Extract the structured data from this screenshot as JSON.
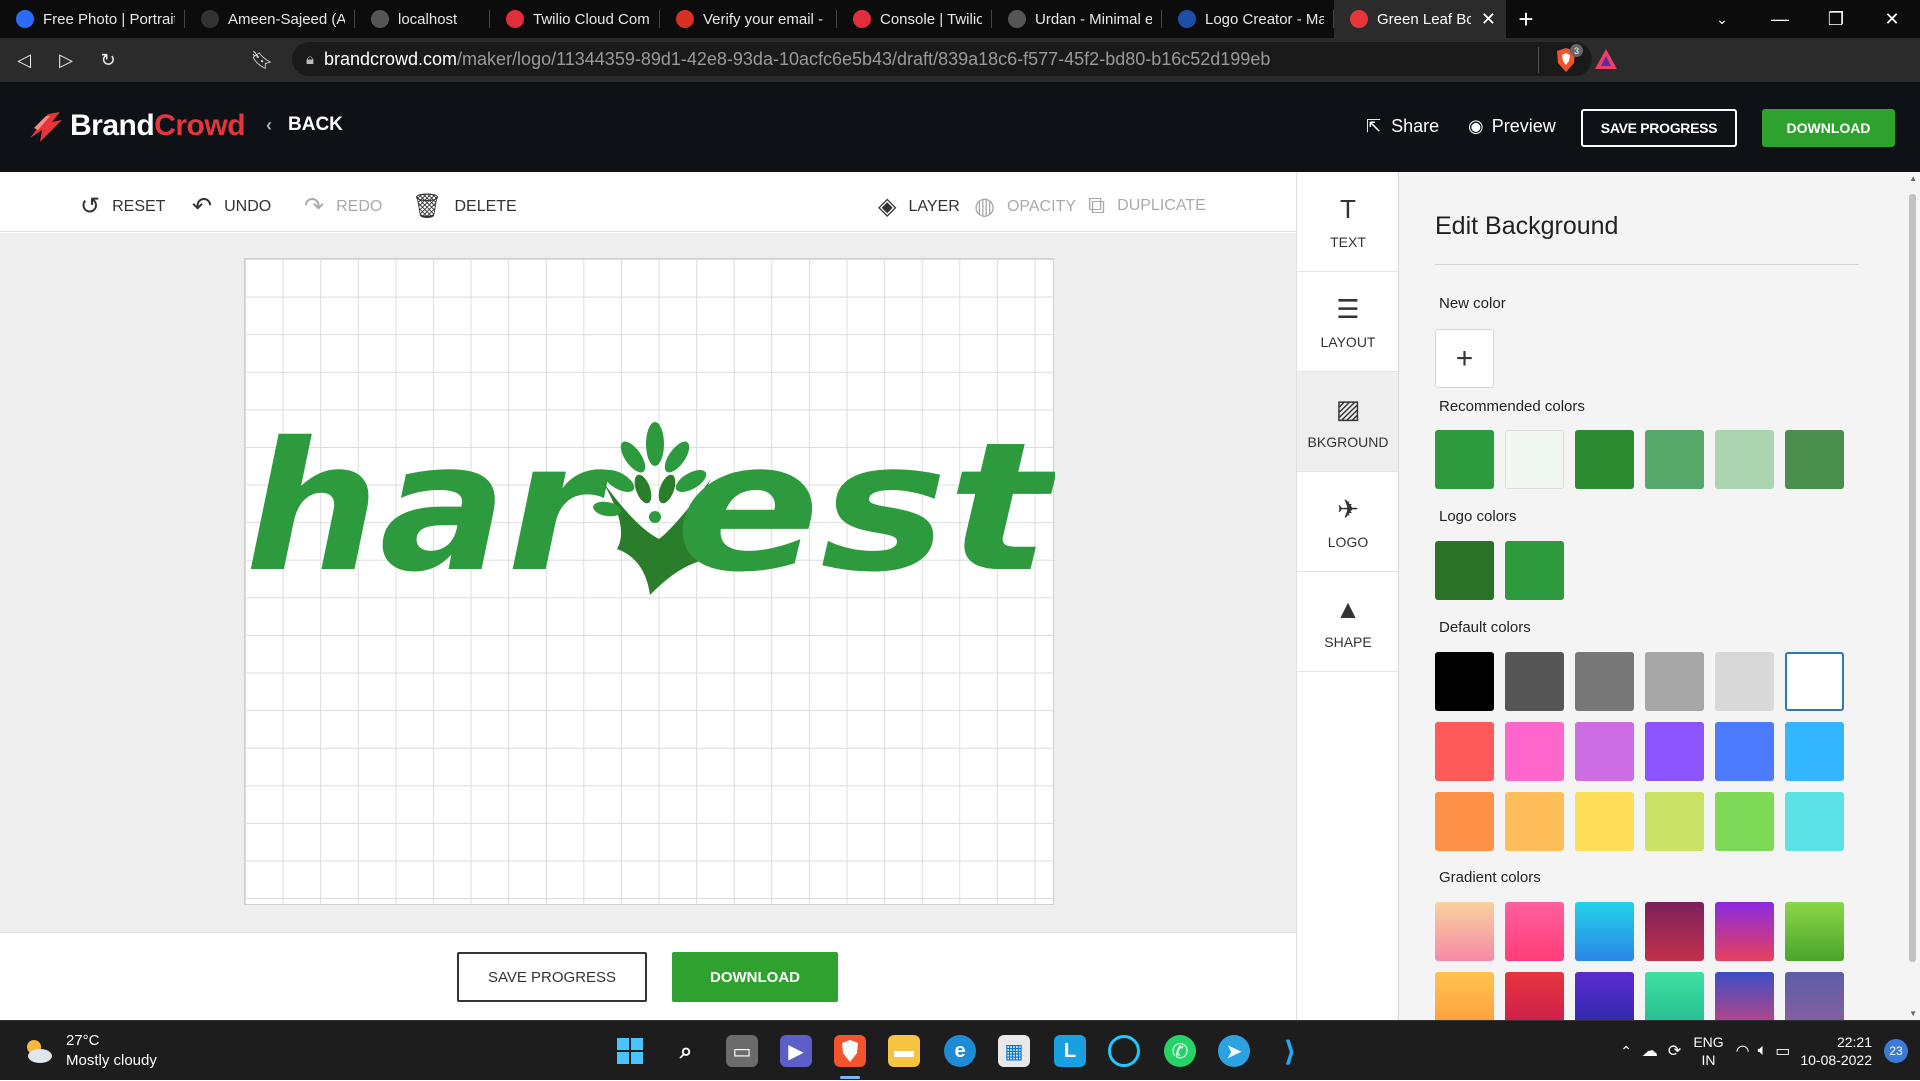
{
  "browser": {
    "tabs": [
      {
        "label": "Free Photo | Portrait",
        "icon": "freepik-icon",
        "color": "#2b6cff"
      },
      {
        "label": "Ameen-Sajeed (AM",
        "icon": "github-icon",
        "color": "#333333"
      },
      {
        "label": "localhost",
        "icon": "globe-icon",
        "color": "#555555"
      },
      {
        "label": "Twilio Cloud Comm",
        "icon": "twilio-icon",
        "color": "#e22d3b"
      },
      {
        "label": "Verify your email - ",
        "icon": "gmail-icon",
        "color": "#d93025"
      },
      {
        "label": "Console | Twilio",
        "icon": "twilio-icon",
        "color": "#e22d3b"
      },
      {
        "label": "Urdan - Minimal eC",
        "icon": "globe-icon",
        "color": "#555555"
      },
      {
        "label": "Logo Creator - Mak",
        "icon": "flo-icon",
        "color": "#1d4fa8"
      },
      {
        "label": "Green Leaf Bou",
        "icon": "brandcrowd-icon",
        "color": "#e6363a",
        "active": true
      }
    ],
    "new_tab": "+",
    "url_host": "brandcrowd.com",
    "url_path": "/maker/logo/11344359-89d1-42e8-93da-10acfc6e5b43/draft/839a18c6-f577-45f2-bd80-b16c52d199eb",
    "brave_badge_count": "3"
  },
  "header": {
    "brand_part1": "Brand",
    "brand_part2": "Crowd",
    "back_label": "BACK",
    "share_label": "Share",
    "preview_label": "Preview",
    "save_label": "SAVE PROGRESS",
    "download_label": "DOWNLOAD"
  },
  "toolbar": {
    "reset_label": "RESET",
    "undo_label": "UNDO",
    "redo_label": "REDO",
    "delete_label": "DELETE",
    "layer_label": "LAYER",
    "opacity_label": "OPACITY",
    "duplicate_label": "DUPLICATE"
  },
  "canvas": {
    "logo_text_left": "har",
    "logo_text_right": "est",
    "logo_color": "#2e9a3e",
    "logo_dark_color": "#2a7d2a"
  },
  "bottom": {
    "save_label": "SAVE PROGRESS",
    "download_label": "DOWNLOAD"
  },
  "sidemenu": {
    "items": [
      {
        "label": "TEXT",
        "icon": "text-icon"
      },
      {
        "label": "LAYOUT",
        "icon": "layout-icon"
      },
      {
        "label": "BKGROUND",
        "icon": "background-icon",
        "active": true
      },
      {
        "label": "LOGO",
        "icon": "logo-icon"
      },
      {
        "label": "SHAPE",
        "icon": "shape-icon"
      }
    ]
  },
  "panel": {
    "title": "Edit Background",
    "new_color_label": "New color",
    "recommended_label": "Recommended colors",
    "recommended_colors": [
      "#2e9a3e",
      "#f1f8f1",
      "#2a8a2f",
      "#57a86a",
      "#abd4b0",
      "#4a8e4d"
    ],
    "logo_colors_label": "Logo colors",
    "logo_colors": [
      "#2a7326",
      "#2e9a3e"
    ],
    "default_label": "Default colors",
    "default_colors": [
      [
        "#000000",
        "#555555",
        "#777777",
        "#a7a7a7",
        "#d8d8d8",
        "#ffffff"
      ],
      [
        "#ff5a5a",
        "#ff66cc",
        "#cc6de3",
        "#8c54ff",
        "#4d7bff",
        "#33b5ff"
      ],
      [
        "#ff9148",
        "#ffbe59",
        "#ffde59",
        "#c9e265",
        "#7ed957",
        "#5ce1e6"
      ]
    ],
    "gradient_label": "Gradient colors",
    "gradient_colors": [
      [
        "#f9d29d",
        "#f58aa7"
      ],
      [
        "#ff5f9e",
        "#ff3d78"
      ],
      [
        "#22d2e8",
        "#2b86e8"
      ],
      [
        "#7a1f5c",
        "#c4314b"
      ],
      [
        "#8a2be2",
        "#e7405b"
      ],
      [
        "#8bd649",
        "#4ba52b"
      ],
      [
        "#ffc44d",
        "#ff9a3d"
      ],
      [
        "#e8343c",
        "#c81d4f"
      ],
      [
        "#5b2bcf",
        "#2a2aa8"
      ],
      [
        "#3fe0a2",
        "#23b98f"
      ],
      [
        "#3b4fc4",
        "#c9437f"
      ],
      [
        "#5c5ea8",
        "#8b5fa0"
      ]
    ]
  },
  "taskbar": {
    "temperature": "27°C",
    "weather": "Mostly cloudy",
    "lang1": "ENG",
    "lang2": "IN",
    "time": "22:21",
    "date": "10-08-2022",
    "notification_count": "23"
  }
}
